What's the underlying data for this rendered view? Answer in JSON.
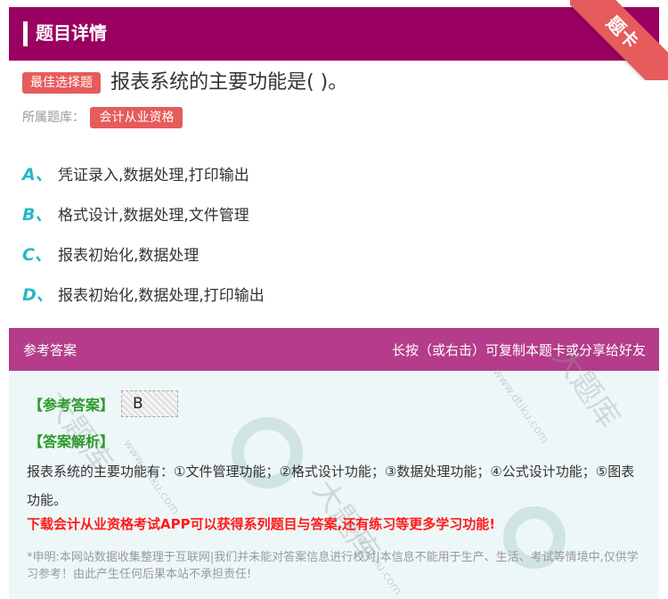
{
  "header": {
    "title": "题目详情"
  },
  "ribbon": {
    "label": "题卡"
  },
  "question": {
    "tag": "最佳选择题",
    "text": "报表系统的主要功能是( )。"
  },
  "source": {
    "label": "所属题库：",
    "library": "会计从业资格"
  },
  "options": [
    {
      "letter": "A、",
      "text": "凭证录入,数据处理,打印输出"
    },
    {
      "letter": "B、",
      "text": "格式设计,数据处理,文件管理"
    },
    {
      "letter": "C、",
      "text": "报表初始化,数据处理"
    },
    {
      "letter": "D、",
      "text": "报表初始化,数据处理,打印输出"
    }
  ],
  "answer_panel": {
    "title": "参考答案",
    "hint": "长按（或右击）可复制本题卡或分享给好友",
    "answer_label": "【参考答案】",
    "answer_value": "B",
    "analysis_label": "【答案解析】",
    "analysis_text": "报表系统的主要功能有：①文件管理功能；②格式设计功能；③数据处理功能；④公式设计功能；⑤图表功能。",
    "promo": "下载会计从业资格考试APP可以获得系列题目与答案,还有练习等更多学习功能!",
    "disclaimer": "*申明:本网站数据收集整理于互联网|我们并未能对答案信息进行校对|本信息不能用于生产、生活、考试等情境中,仅供学习参考！由此产生任何后果本站不承担责任!"
  },
  "watermark": {
    "text": "大题库",
    "url": "www.dtiku.com"
  },
  "colors": {
    "header_bg": "#99005f",
    "answer_head_bg": "#b43c8a",
    "tag_red": "#e65b5b",
    "option_letter": "#2bb7c6",
    "answer_green": "#2e9a2e",
    "promo_red": "#ff1a1a"
  }
}
